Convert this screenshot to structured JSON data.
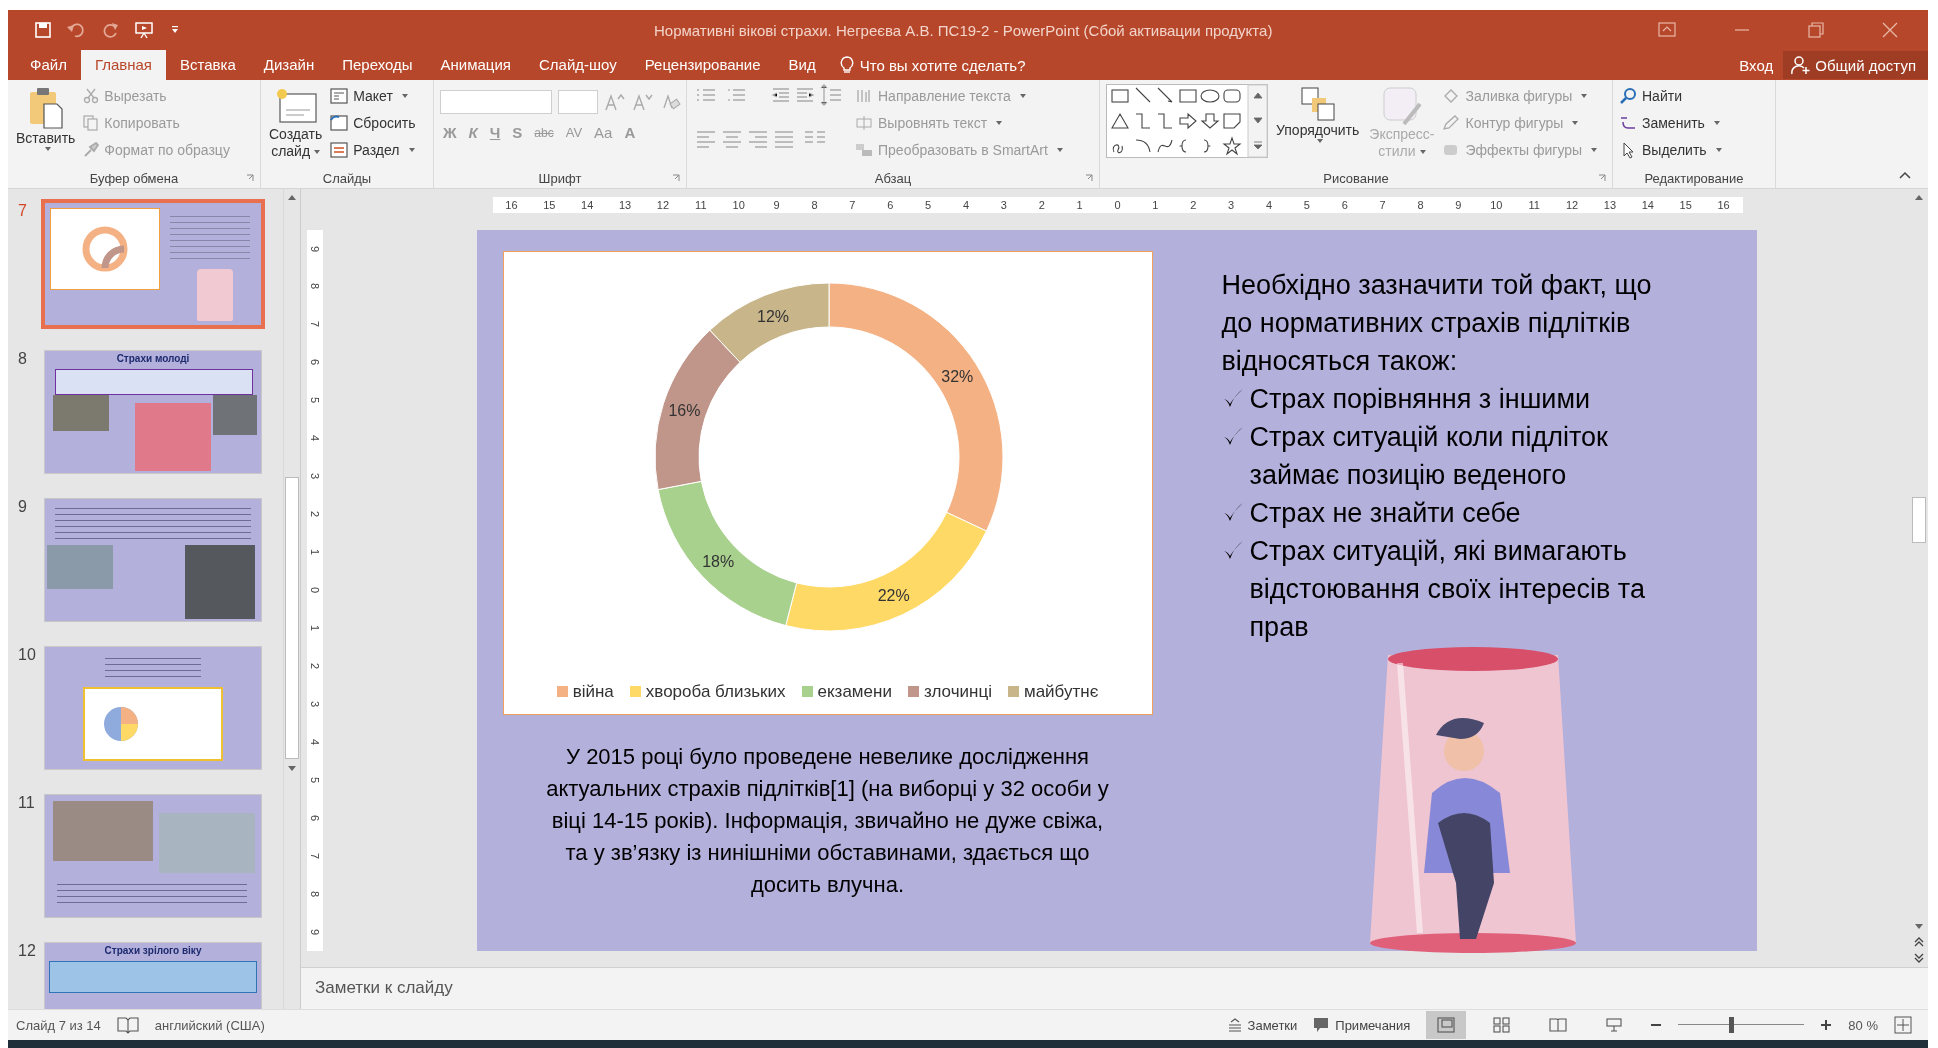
{
  "window": {
    "title": "Нормативні вікові страхи. Негреєва А.В. ПС19-2 - PowerPoint (Сбой активации продукта)"
  },
  "tabs": [
    {
      "label": "Файл",
      "selected": false
    },
    {
      "label": "Главная",
      "selected": true
    },
    {
      "label": "Вставка",
      "selected": false
    },
    {
      "label": "Дизайн",
      "selected": false
    },
    {
      "label": "Переходы",
      "selected": false
    },
    {
      "label": "Анимация",
      "selected": false
    },
    {
      "label": "Слайд-шоу",
      "selected": false
    },
    {
      "label": "Рецензирование",
      "selected": false
    },
    {
      "label": "Вид",
      "selected": false
    }
  ],
  "tell_me": "Что вы хотите сделать?",
  "sign_in": "Вход",
  "share": "Общий доступ",
  "ribbon": {
    "clipboard": {
      "label": "Буфер обмена",
      "paste": "Вставить",
      "items": [
        {
          "label": "Вырезать",
          "disabled": true
        },
        {
          "label": "Копировать",
          "disabled": true
        },
        {
          "label": "Формат по образцу",
          "disabled": true
        }
      ]
    },
    "slides": {
      "label": "Слайды",
      "new_slide": [
        "Создать",
        "слайд"
      ],
      "items": [
        {
          "label": "Макет",
          "disabled": false
        },
        {
          "label": "Сбросить",
          "disabled": false
        },
        {
          "label": "Раздел",
          "disabled": false
        }
      ]
    },
    "font": {
      "label": "Шрифт",
      "buttons": [
        "Ж",
        "К",
        "Ч",
        "S",
        "abc",
        "AV",
        "Aa",
        "A"
      ]
    },
    "paragraph": {
      "label": "Абзац",
      "items": [
        {
          "label": "Направление текста",
          "disabled": true
        },
        {
          "label": "Выровнять текст",
          "disabled": true
        },
        {
          "label": "Преобразовать в SmartArt",
          "disabled": true
        }
      ]
    },
    "drawing": {
      "label": "Рисование",
      "arrange": "Упорядочить",
      "styles": [
        "Экспресс-",
        "стили"
      ],
      "items": [
        {
          "label": "Заливка фигуры",
          "disabled": true
        },
        {
          "label": "Контур фигуры",
          "disabled": true
        },
        {
          "label": "Эффекты фигуры",
          "disabled": true
        }
      ]
    },
    "editing": {
      "label": "Редактирование",
      "items": [
        {
          "label": "Найти",
          "disabled": false
        },
        {
          "label": "Заменить",
          "disabled": false
        },
        {
          "label": "Выделить",
          "disabled": false
        }
      ]
    }
  },
  "thumbnails": [
    {
      "number": "7",
      "selected": true,
      "kind": "chart"
    },
    {
      "number": "8",
      "selected": false,
      "kind": "boxes",
      "title": "Страхи молоді"
    },
    {
      "number": "9",
      "selected": false,
      "kind": "textphotos"
    },
    {
      "number": "10",
      "selected": false,
      "kind": "pie"
    },
    {
      "number": "11",
      "selected": false,
      "kind": "photostext"
    },
    {
      "number": "12",
      "selected": false,
      "kind": "diagram",
      "title": "Страхи зрілого віку"
    }
  ],
  "ruler": {
    "horizontal": [
      "16",
      "15",
      "14",
      "13",
      "12",
      "11",
      "10",
      "9",
      "8",
      "7",
      "6",
      "5",
      "4",
      "3",
      "2",
      "1",
      "0",
      "1",
      "2",
      "3",
      "4",
      "5",
      "6",
      "7",
      "8",
      "9",
      "10",
      "11",
      "12",
      "13",
      "14",
      "15",
      "16"
    ],
    "vertical": [
      "9",
      "8",
      "7",
      "6",
      "5",
      "4",
      "3",
      "2",
      "1",
      "0",
      "1",
      "2",
      "3",
      "4",
      "5",
      "6",
      "7",
      "8",
      "9"
    ]
  },
  "slide": {
    "chart_data": {
      "type": "donut",
      "categories": [
        "війна",
        "хвороба близьких",
        "екзамени",
        "злочинці",
        "майбутнє"
      ],
      "values": [
        32,
        22,
        18,
        16,
        12
      ],
      "legend": true,
      "colors": [
        "#f4b183",
        "#ffd966",
        "#a9d18e",
        "#c0958a",
        "#c8b58a"
      ],
      "value_labels": [
        "32%",
        "22%",
        "18%",
        "16%",
        "12%"
      ]
    },
    "intro": "Необхідно зазначити той факт, що до нормативних страхів підлітків відносяться також:",
    "checklist": [
      "Страх порівняння з іншими",
      "Страх ситуацій коли підліток займає позицію веденого",
      "Страх не знайти себе",
      "Страх ситуацій, які вимагають відстоювання своїх інтересів та прав"
    ],
    "description": "У 2015 році було проведене невелике дослідження актуальних страхів підлітків[1] (на виборці у 32 особи у віці 14-15 років). Інформація, звичайно не дуже свіжа, та у зв’язку із нинішніми обставинами, здається що досить влучна."
  },
  "notes_placeholder": "Заметки к слайду",
  "status_bar": {
    "slide": "Слайд 7 из 14",
    "language": "английский (США)",
    "notes": "Заметки",
    "comments": "Примечания",
    "views": [
      {
        "selected": true
      },
      {
        "selected": false
      },
      {
        "selected": false
      },
      {
        "selected": false
      }
    ],
    "zoom": {
      "level": 0.42,
      "reading": "80 %"
    }
  }
}
